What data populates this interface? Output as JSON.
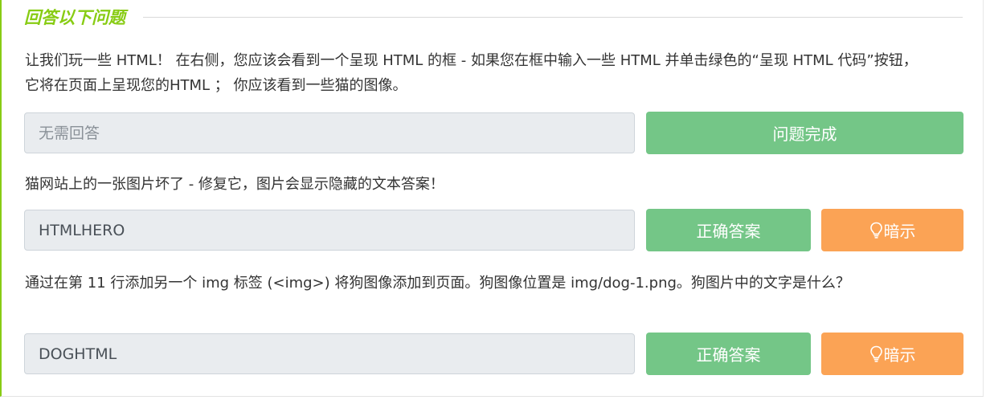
{
  "section": {
    "title": "回答以下问题"
  },
  "questions": [
    {
      "text": "让我们玩一些 HTML！ 在右侧，您应该会看到一个呈现 HTML 的框 - 如果您在框中输入一些 HTML 并单击绿色的“呈现 HTML 代码”按钮，它将在页面上呈现您的HTML ； 你应该看到一些猫的图像。",
      "answer_placeholder": "无需回答",
      "answer_value": "",
      "submit_label": "问题完成"
    },
    {
      "text": "猫网站上的一张图片坏了 - 修复它，图片会显示隐藏的文本答案！",
      "answer_value": "HTMLHERO",
      "submit_label": "正确答案",
      "hint_label": "暗示"
    },
    {
      "text": "通过在第 11 行添加另一个 img 标签 (<img>) 将狗图像添加到页面。狗图像位置是 img/dog-1.png。狗图片中的文字是什么？",
      "answer_value": "DOGHTML",
      "submit_label": "正确答案",
      "hint_label": "暗示"
    }
  ],
  "colors": {
    "accent": "#88cc14",
    "success_button": "#74c687",
    "hint_button": "#fba355",
    "field_background": "#e9ecef"
  },
  "icons": {
    "hint": "lightbulb-icon"
  }
}
